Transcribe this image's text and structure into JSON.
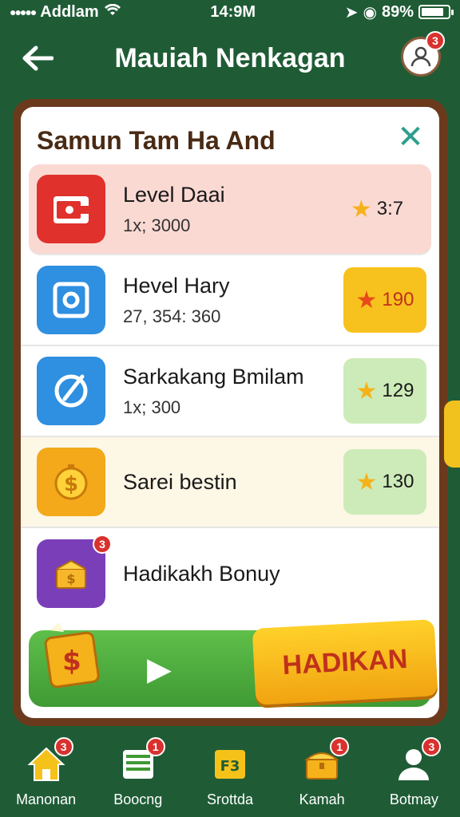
{
  "status_bar": {
    "carrier": "Addlam",
    "time": "14:9M",
    "battery": "89%"
  },
  "header": {
    "title": "Mauiah Nenkagan",
    "profile_badge": "3"
  },
  "panel": {
    "title": "Samun Tam Ha And",
    "rows": [
      {
        "title": "Level Daai",
        "sub": "1x; 3000",
        "score": "3:7",
        "icon": "wallet-icon",
        "color": "#e0312c"
      },
      {
        "title": "Hevel Hary",
        "sub": "27, 354: 360",
        "score": "190",
        "icon": "camera-icon",
        "color": "#2f8fe0"
      },
      {
        "title": "Sarkakang Bmilam",
        "sub": "1x; 300",
        "score": "129",
        "icon": "compass-icon",
        "color": "#2f8fe0"
      },
      {
        "title": "Sarei bestin",
        "sub": "",
        "score": "130",
        "icon": "dollar-coin-icon",
        "color": "#f3a91a"
      },
      {
        "title": "Hadikakh Bonuy",
        "sub": "",
        "score": "",
        "icon": "gift-box-icon",
        "color": "#7a3fb8",
        "badge": "3"
      }
    ],
    "cta_label": "HADIKAN"
  },
  "bottom_nav": [
    {
      "label": "Manonan",
      "icon": "home-icon",
      "badge": "3"
    },
    {
      "label": "Boocng",
      "icon": "list-icon",
      "badge": "1"
    },
    {
      "label": "Srottda",
      "icon": "ticket-icon",
      "badge": ""
    },
    {
      "label": "Kamah",
      "icon": "chest-icon",
      "badge": "1"
    },
    {
      "label": "Botmay",
      "icon": "user-icon",
      "badge": "3"
    }
  ],
  "colors": {
    "background": "#1f5c36",
    "panel_border": "#6b3a1d",
    "accent_yellow": "#f5b21a",
    "cta_green": "#4fae3e"
  }
}
